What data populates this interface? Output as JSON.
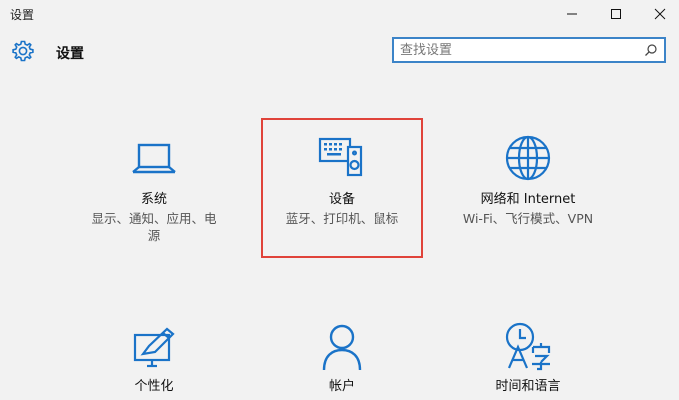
{
  "window": {
    "title": "设置"
  },
  "header": {
    "title": "设置",
    "icon": "gear-icon"
  },
  "search": {
    "placeholder": "查找设置",
    "value": ""
  },
  "tiles": [
    {
      "title": "系统",
      "desc_line1": "显示、通知、应用、电",
      "desc_line2": "源",
      "icon": "laptop-icon"
    },
    {
      "title": "设备",
      "desc_line1": "蓝牙、打印机、鼠标",
      "icon": "devices-icon"
    },
    {
      "title": "网络和 Internet",
      "desc_line1": "Wi-Fi、飞行模式、VPN",
      "icon": "globe-icon"
    },
    {
      "title": "个性化",
      "icon": "personalization-icon"
    },
    {
      "title": "帐户",
      "icon": "person-icon"
    },
    {
      "title": "时间和语言",
      "icon": "time-language-icon"
    }
  ],
  "colors": {
    "accent": "#1a73c8",
    "highlight": "#e0433a",
    "background": "#f2f2f2"
  }
}
